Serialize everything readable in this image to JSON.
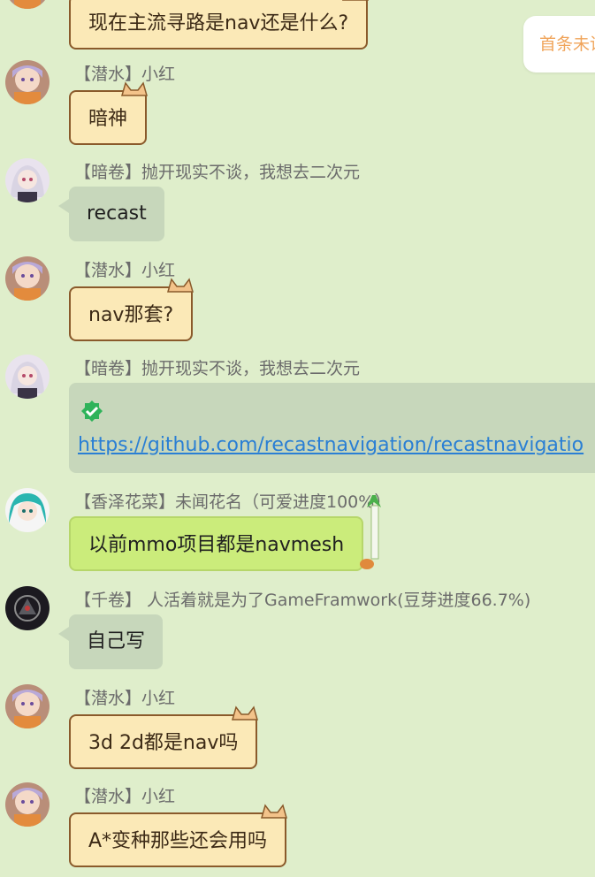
{
  "unread_pill": {
    "label": "首条未读"
  },
  "messages": [
    {
      "id": "m0",
      "sender": "",
      "text": "现在主流寻路是nav还是什么?",
      "style": "cat",
      "avatar": "purple-hair-girl"
    },
    {
      "id": "m1",
      "sender": "【潜水】小红",
      "text": "暗神",
      "style": "cat",
      "avatar": "purple-hair-girl"
    },
    {
      "id": "m2",
      "sender": "【暗卷】抛开现实不谈，我想去二次元",
      "text": "recast",
      "style": "grey",
      "avatar": "white-hair-girl"
    },
    {
      "id": "m3",
      "sender": "【潜水】小红",
      "text": "nav那套?",
      "style": "cat",
      "avatar": "purple-hair-girl"
    },
    {
      "id": "m4",
      "sender": "【暗卷】抛开现实不谈，我想去二次元",
      "text": "https://github.com/recastnavigation/recastnavigatio",
      "style": "link",
      "avatar": "white-hair-girl"
    },
    {
      "id": "m5",
      "sender": "【香泽花菜】未闻花名（可爱进度100%）",
      "text": "以前mmo项目都是navmesh",
      "style": "green",
      "avatar": "teal-hair-girl"
    },
    {
      "id": "m6",
      "sender": "【千卷】 人活着就是为了GameFramwork(豆芽进度66.7%)",
      "text": "自己写",
      "style": "grey",
      "avatar": "dark-avatar"
    },
    {
      "id": "m7",
      "sender": "【潜水】小红",
      "text": "3d 2d都是nav吗",
      "style": "cat",
      "avatar": "purple-hair-girl"
    },
    {
      "id": "m8",
      "sender": "【潜水】小红",
      "text": "A*变种那些还会用吗",
      "style": "cat",
      "avatar": "purple-hair-girl"
    }
  ],
  "colors": {
    "background": "#dfeecb",
    "cat_bubble": "#fbe9b7",
    "grey_bubble": "#c7d7bb",
    "green_bubble": "#cbec7b",
    "link": "#2a7fd4",
    "unread_text": "#f0a45a"
  }
}
